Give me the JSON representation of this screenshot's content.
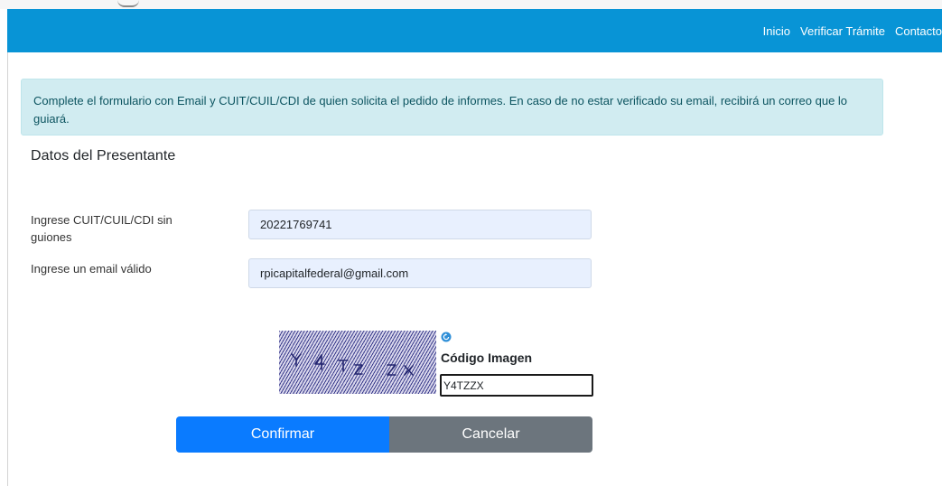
{
  "navbar": {
    "links": [
      "Inicio",
      "Verificar Trámite",
      "Contacto"
    ],
    "color": "#0894d6"
  },
  "alert": {
    "text": "Complete el formulario con Email y CUIT/CUIL/CDI de quien solicita el pedido de informes. En caso de no estar verificado su email, recibirá un correo que lo guiará."
  },
  "section": {
    "title": "Datos del Presentante"
  },
  "form": {
    "cuit": {
      "label": "Ingrese CUIT/CUIL/CDI sin guiones",
      "value": "20221769741"
    },
    "email": {
      "label": "Ingrese un email válido",
      "value": "rpicapitalfederal@gmail.com"
    }
  },
  "captcha": {
    "image_text": "Y4TZZX",
    "label": "Código Imagen",
    "value": "Y4TZZX",
    "refresh_icon": "refresh-icon"
  },
  "buttons": {
    "confirm": "Confirmar",
    "cancel": "Cancelar",
    "confirm_color": "#0a7bff",
    "cancel_color": "#6c757d"
  }
}
